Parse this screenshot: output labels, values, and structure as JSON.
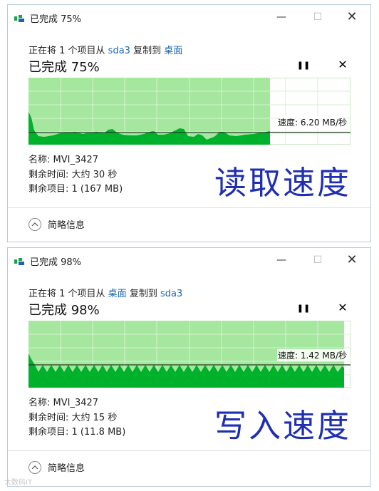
{
  "colors": {
    "accent": "#1a64b3",
    "graph_fill": "#00b12b",
    "graph_bg": "#a6e7a0",
    "overlay_text": "#1f2fb3"
  },
  "window_controls": {
    "minimize_icon": "minimize-icon",
    "maximize_icon": "maximize-icon",
    "close_icon": "close-icon"
  },
  "dialogs": [
    {
      "title": "已完成 75%",
      "op_prefix": "正在将 1 个项目从 ",
      "source": "sda3",
      "op_middle": " 复制到 ",
      "dest": "桌面",
      "percent_text": "已完成 75%",
      "progress": 0.75,
      "speed_label": "速度: 6.20 MB/秒",
      "name_row": "名称: MVI_3427",
      "time_row": "剩余时间: 大约 30 秒",
      "items_row": "剩余项目: 1 (167 MB)",
      "overlay": "读取速度",
      "more_label": "简略信息"
    },
    {
      "title": "已完成 98%",
      "op_prefix": "正在将 1 个项目从 ",
      "source": "桌面",
      "op_middle": " 复制到 ",
      "dest": "sda3",
      "percent_text": "已完成 98%",
      "progress": 0.98,
      "speed_label": "速度: 1.42 MB/秒",
      "name_row": "名称: MVI_3427",
      "time_row": "剩余时间: 大约 15 秒",
      "items_row": "剩余项目: 1 (11.8 MB)",
      "overlay": "写入速度",
      "more_label": "简略信息"
    }
  ],
  "watermark": "大数码IT"
}
